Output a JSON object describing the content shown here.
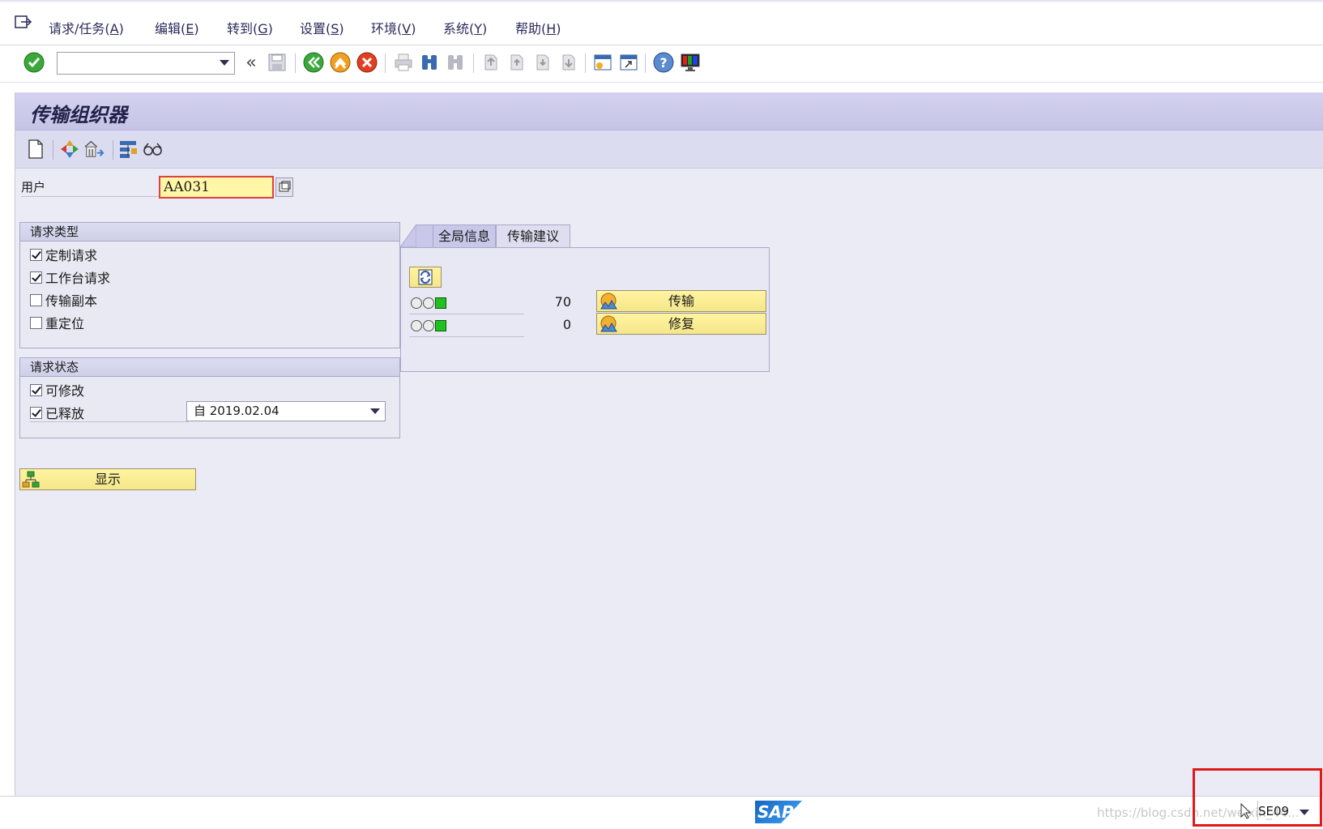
{
  "menubar": {
    "items": [
      {
        "label": "请求/任务(",
        "key": "A",
        "suffix": ")"
      },
      {
        "label": "编辑(",
        "key": "E",
        "suffix": ")"
      },
      {
        "label": "转到(",
        "key": "G",
        "suffix": ")"
      },
      {
        "label": "设置(",
        "key": "S",
        "suffix": ")"
      },
      {
        "label": "环境(",
        "key": "V",
        "suffix": ")"
      },
      {
        "label": "系统(",
        "key": "Y",
        "suffix": ")"
      },
      {
        "label": "帮助(",
        "key": "H",
        "suffix": ")"
      }
    ]
  },
  "toolbar": {
    "command_value": ""
  },
  "screen": {
    "title": "传输组织器"
  },
  "user_field": {
    "label": "用户",
    "value": "AA031"
  },
  "request_type": {
    "header": "请求类型",
    "options": [
      {
        "label": "定制请求",
        "checked": true
      },
      {
        "label": "工作台请求",
        "checked": true
      },
      {
        "label": "传输副本",
        "checked": false
      },
      {
        "label": "重定位",
        "checked": false
      }
    ]
  },
  "request_status": {
    "header": "请求状态",
    "options": [
      {
        "label": "可修改",
        "checked": true
      },
      {
        "label": "已释放",
        "checked": true
      }
    ],
    "date_selector": "自 2019.02.04"
  },
  "display_button": "显示",
  "tabs": {
    "items": [
      "全局信息",
      "传输建议"
    ],
    "active": 0
  },
  "global_info": {
    "rows": [
      {
        "count": "70",
        "button": "传输"
      },
      {
        "count": "0",
        "button": "修复"
      }
    ]
  },
  "statusbar": {
    "watermark": "https://blog.csdn.net/weixin_44...",
    "tcode": "SE09",
    "logo": "SAP"
  },
  "colors": {
    "main_bg": "#ebebf6",
    "title_bg": "#c6c4e6",
    "button_yellow": "#fff4a0",
    "highlight_red": "#e01818"
  }
}
